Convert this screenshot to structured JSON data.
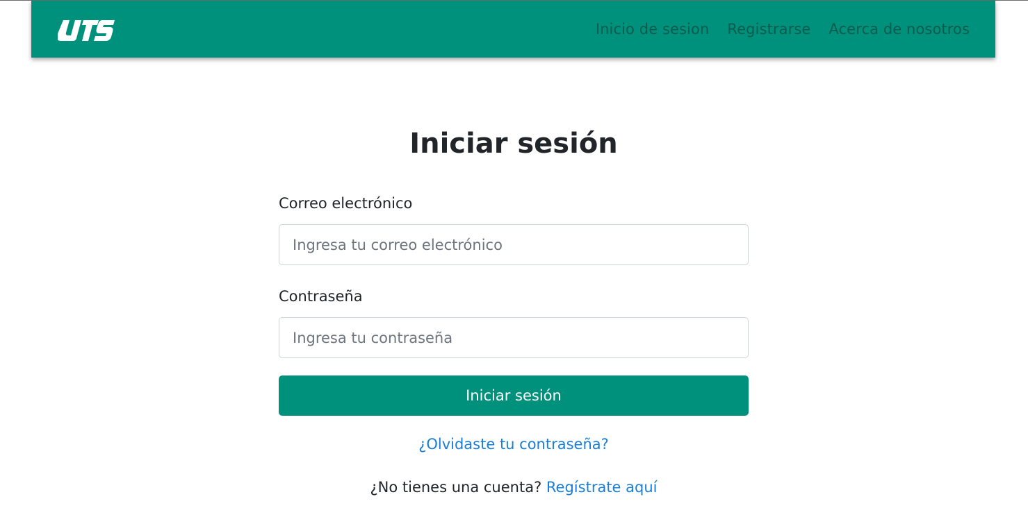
{
  "brand": {
    "logo_text": "UTS",
    "color": "#00917c"
  },
  "nav": {
    "items": [
      {
        "label": "Inicio de sesion"
      },
      {
        "label": "Registrarse"
      },
      {
        "label": "Acerca de nosotros"
      }
    ],
    "link_color": "#0c5b4f"
  },
  "login": {
    "title": "Iniciar sesión",
    "email_label": "Correo electrónico",
    "email_placeholder": "Ingresa tu correo electrónico",
    "email_value": "",
    "password_label": "Contraseña",
    "password_placeholder": "Ingresa tu contraseña",
    "password_value": "",
    "submit_label": "Iniciar sesión",
    "forgot_label": "¿Olvidaste tu contraseña?",
    "no_account_text": "¿No tienes una cuenta?",
    "register_link_label": "Regístrate aquí",
    "link_color": "#1a7ed6"
  }
}
